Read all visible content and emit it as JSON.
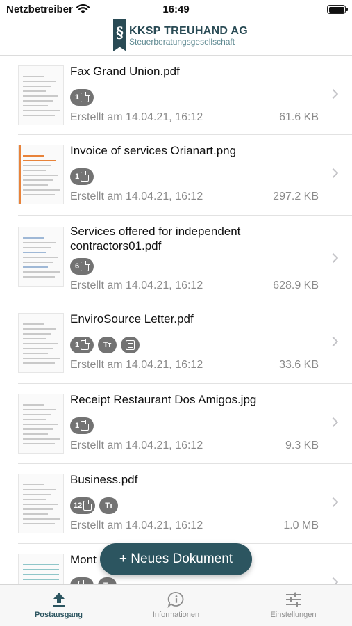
{
  "status_bar": {
    "carrier": "Netzbetreiber",
    "time": "16:49",
    "battery_level": 1.0
  },
  "header": {
    "logo_symbol": "§",
    "logo_name": "KKSP TREUHAND AG",
    "logo_subtitle": "Steuerberatungsgesellschaft"
  },
  "documents": [
    {
      "title": "Fax Grand Union.pdf",
      "badges": [
        {
          "type": "pages",
          "count": "1"
        }
      ],
      "date": "Erstellt am 14.04.21, 16:12",
      "size": "61.6 KB",
      "thumbnail": "fax-cover-thumbnail"
    },
    {
      "title": "Invoice of services Orianart.png",
      "badges": [
        {
          "type": "pages",
          "count": "1"
        }
      ],
      "date": "Erstellt am 14.04.21, 16:12",
      "size": "297.2 KB",
      "thumbnail": "invoice-thumbnail"
    },
    {
      "title": "Services offered for independent contractors01.pdf",
      "badges": [
        {
          "type": "pages",
          "count": "6"
        }
      ],
      "date": "Erstellt am 14.04.21, 16:12",
      "size": "628.9 KB",
      "thumbnail": "form-thumbnail"
    },
    {
      "title": "EnviroSource Letter.pdf",
      "badges": [
        {
          "type": "pages",
          "count": "1"
        },
        {
          "type": "text"
        },
        {
          "type": "scan"
        }
      ],
      "date": "Erstellt am 14.04.21, 16:12",
      "size": "33.6 KB",
      "thumbnail": "letter-thumbnail"
    },
    {
      "title": "Receipt Restaurant Dos Amigos.jpg",
      "badges": [
        {
          "type": "pages",
          "count": "1"
        }
      ],
      "date": "Erstellt am 14.04.21, 16:12",
      "size": "9.3 KB",
      "thumbnail": "receipt-thumbnail"
    },
    {
      "title": "Business.pdf",
      "badges": [
        {
          "type": "pages",
          "count": "12"
        },
        {
          "type": "text"
        }
      ],
      "date": "Erstellt am 14.04.21, 16:12",
      "size": "1.0 MB",
      "thumbnail": "business-thumbnail"
    },
    {
      "title": "Mont",
      "badges": [
        {
          "type": "pages",
          "count": ""
        },
        {
          "type": "text"
        }
      ],
      "date": "",
      "size": "",
      "thumbnail": "spreadsheet-thumbnail"
    }
  ],
  "badge_text_glyph": "Tт",
  "fab": {
    "label": "+ Neues Dokument"
  },
  "tabs": [
    {
      "label": "Postausgang",
      "icon": "upload-icon",
      "active": true
    },
    {
      "label": "Informationen",
      "icon": "info-icon",
      "active": false
    },
    {
      "label": "Einstellungen",
      "icon": "sliders-icon",
      "active": false
    }
  ],
  "colors": {
    "accent": "#2c5560",
    "badge": "#737373",
    "secondary_text": "#8a8a8a"
  }
}
